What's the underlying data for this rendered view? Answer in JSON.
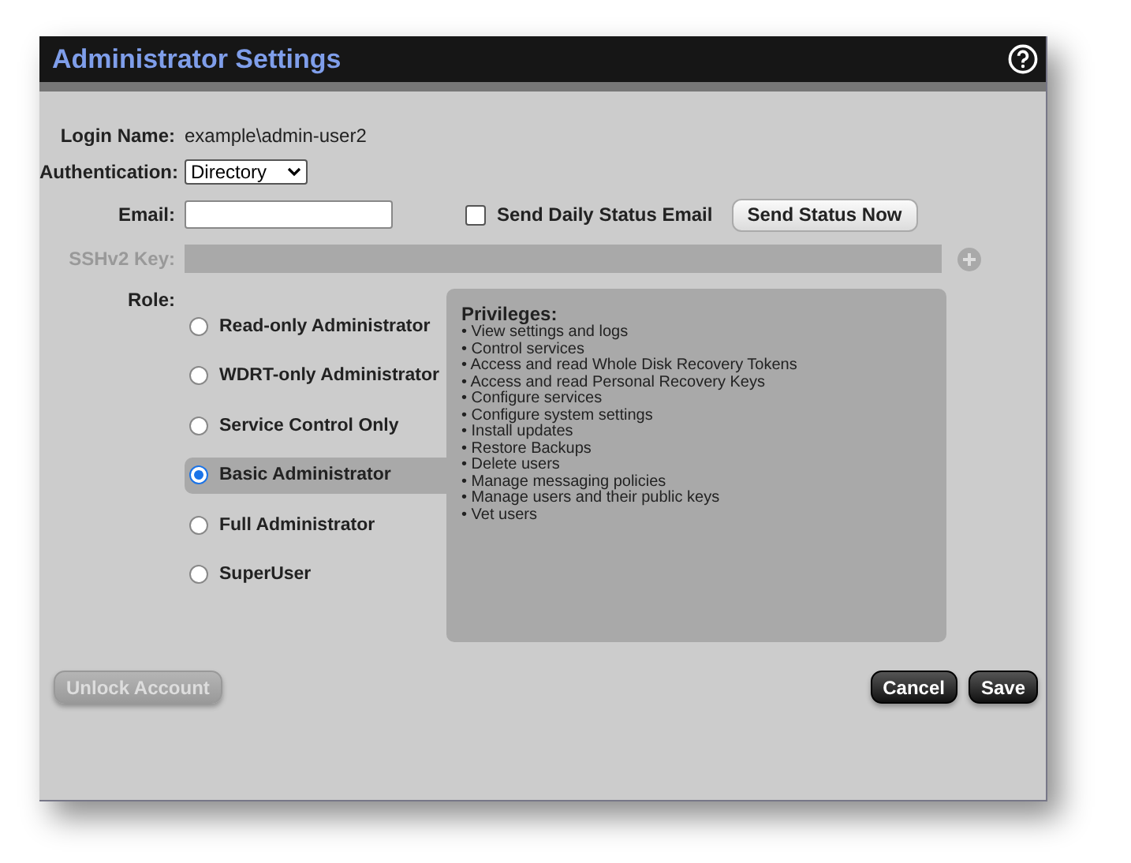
{
  "window": {
    "title": "Administrator Settings"
  },
  "login_name": {
    "label": "Login Name:",
    "value": "example\\admin-user2"
  },
  "authentication": {
    "label": "Authentication:",
    "value": "Directory"
  },
  "email": {
    "label": "Email:"
  },
  "send_daily": {
    "label": "Send Daily Status Email",
    "checked": false
  },
  "send_status_button": {
    "label": "Send Status Now"
  },
  "sshv2": {
    "label": "SSHv2 Key:",
    "disabled": true
  },
  "role": {
    "label": "Role:",
    "options": [
      {
        "label": "Read-only Administrator",
        "selected": false
      },
      {
        "label": "WDRT-only Administrator",
        "selected": false
      },
      {
        "label": "Service Control Only",
        "selected": false
      },
      {
        "label": "Basic Administrator",
        "selected": true
      },
      {
        "label": "Full Administrator",
        "selected": false
      },
      {
        "label": "SuperUser",
        "selected": false
      }
    ]
  },
  "privileges": {
    "title": "Privileges:",
    "items": [
      "• View settings and logs",
      "• Control services",
      "• Access and read Whole Disk Recovery Tokens",
      "• Access and read Personal Recovery Keys",
      "• Configure services",
      "• Configure system settings",
      "• Install updates",
      "• Restore Backups",
      "• Delete users",
      "• Manage messaging policies",
      "• Manage users and their public keys",
      "• Vet users"
    ]
  },
  "buttons": [
    {
      "label": "Unlock Account",
      "disabled": true
    },
    {
      "label": "Cancel",
      "disabled": false
    },
    {
      "label": "Save",
      "disabled": false
    }
  ]
}
